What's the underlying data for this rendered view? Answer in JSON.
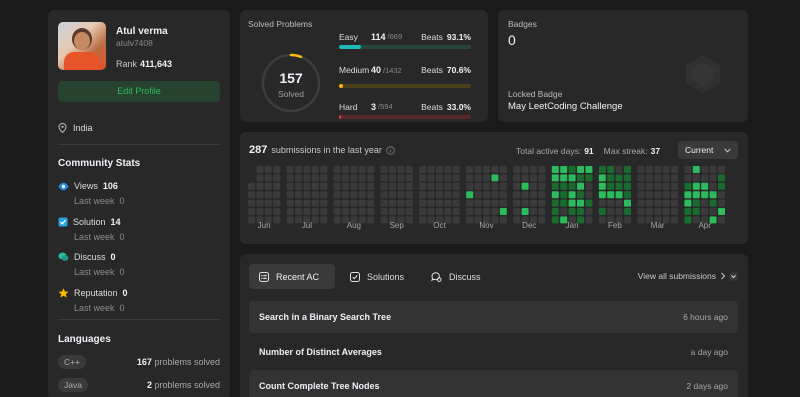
{
  "colors": {
    "easy": "#1cbaba",
    "medium": "#ffb700",
    "hard": "#f63737",
    "accent": "#2cbb5d",
    "card": "#282828",
    "bg": "#1a1a1a"
  },
  "profile": {
    "name": "Atul verma",
    "username": "atulv7408",
    "rank_label": "Rank",
    "rank_value": "411,643",
    "edit_button": "Edit Profile",
    "location": "India"
  },
  "community": {
    "title": "Community Stats",
    "items": [
      {
        "label": "Views",
        "value": "106",
        "sub": "Last week",
        "sub_value": "0",
        "icon": "eye-icon"
      },
      {
        "label": "Solution",
        "value": "14",
        "sub": "Last week",
        "sub_value": "0",
        "icon": "check-square-icon"
      },
      {
        "label": "Discuss",
        "value": "0",
        "sub": "Last week",
        "sub_value": "0",
        "icon": "chat-icon"
      },
      {
        "label": "Reputation",
        "value": "0",
        "sub": "Last week",
        "sub_value": "0",
        "icon": "star-icon"
      }
    ]
  },
  "languages": {
    "title": "Languages",
    "items": [
      {
        "name": "C++",
        "count": "167",
        "suffix": "problems solved"
      },
      {
        "name": "Java",
        "count": "2",
        "suffix": "problems solved"
      }
    ]
  },
  "solved": {
    "title": "Solved Problems",
    "total": "157",
    "total_label": "Solved",
    "rows": [
      {
        "label": "Easy",
        "solved": "114",
        "total": "/669",
        "beats_label": "Beats",
        "beats": "93.1%",
        "fraction": 0.17
      },
      {
        "label": "Medium",
        "solved": "40",
        "total": "/1432",
        "beats_label": "Beats",
        "beats": "70.6%",
        "fraction": 0.03
      },
      {
        "label": "Hard",
        "solved": "3",
        "total": "/594",
        "beats_label": "Beats",
        "beats": "33.0%",
        "fraction": 0.005
      }
    ]
  },
  "badges": {
    "title": "Badges",
    "count": "0",
    "locked_label": "Locked Badge",
    "locked_name": "May LeetCoding Challenge"
  },
  "submissions": {
    "count": "287",
    "label": "submissions in the last year",
    "active_label": "Total active days:",
    "active_value": "91",
    "streak_label": "Max streak:",
    "streak_value": "37",
    "dropdown": "Current",
    "months": [
      "Jun",
      "Jul",
      "Aug",
      "Sep",
      "Oct",
      "Nov",
      "Dec",
      "Jan",
      "Feb",
      "Mar",
      "Apr"
    ],
    "activity_levels": [
      [
        0,
        0,
        0,
        0,
        0,
        0,
        0,
        0,
        0,
        0,
        0,
        0,
        0,
        0,
        0,
        0,
        0,
        0,
        0,
        0,
        0,
        0,
        0,
        0,
        0,
        0,
        0,
        0,
        0,
        0,
        0,
        0,
        0,
        0,
        0,
        0,
        0,
        0,
        0,
        0,
        0,
        0,
        0,
        0,
        0,
        0,
        0,
        0,
        0,
        0,
        0,
        0,
        0,
        0,
        0,
        0,
        0,
        0,
        0,
        0,
        0,
        0,
        0,
        0,
        0,
        0,
        0,
        0,
        0,
        0,
        0,
        0,
        0,
        0,
        0,
        0,
        0,
        0,
        0,
        0,
        0,
        0,
        0,
        0,
        0,
        0,
        0,
        0,
        0,
        0,
        0,
        0,
        0,
        0,
        0,
        0,
        0,
        0,
        0,
        0,
        0,
        0,
        0,
        0,
        0,
        0,
        0,
        0,
        0,
        0,
        0,
        0,
        0,
        0,
        0,
        0,
        0,
        0,
        0,
        0,
        0,
        0,
        0,
        0,
        0,
        0,
        0,
        0,
        0,
        0,
        0,
        0,
        0,
        0,
        0,
        0,
        0,
        0,
        0,
        0,
        0,
        0,
        0,
        0,
        0,
        0,
        0,
        0,
        0,
        0,
        0,
        0,
        0,
        0,
        0,
        0,
        0,
        0,
        0,
        0,
        0,
        0,
        0,
        0,
        0,
        0,
        0,
        0,
        0,
        0,
        0,
        0,
        0,
        0,
        0,
        0,
        0,
        0,
        0,
        0,
        0,
        0,
        0,
        0,
        0,
        0,
        0,
        0,
        0,
        0,
        0,
        0,
        0,
        0,
        0,
        0,
        0,
        0,
        0,
        0,
        0,
        0,
        0,
        0,
        0,
        0,
        0,
        0,
        0,
        0,
        0,
        0,
        0,
        0,
        0,
        0,
        0,
        0,
        0,
        0,
        0,
        0,
        0,
        0,
        0,
        0,
        0,
        0,
        0,
        0,
        0,
        0,
        0,
        0,
        0,
        0,
        0,
        0,
        0,
        0,
        0,
        0,
        0,
        0,
        0,
        0,
        0,
        0,
        0,
        0,
        0,
        0,
        0,
        0,
        0,
        0,
        0,
        0,
        0,
        0,
        0,
        0,
        0,
        0,
        0,
        0,
        0,
        0,
        0,
        0,
        0,
        0,
        0,
        0,
        0,
        0,
        0,
        0,
        0,
        0,
        0,
        0,
        0,
        0,
        0,
        0,
        0,
        0,
        0,
        0,
        0,
        0,
        0,
        0,
        0,
        0,
        0,
        0,
        0,
        0,
        0,
        0,
        0,
        0,
        0,
        0,
        0,
        0,
        0,
        0,
        0,
        0,
        0,
        0,
        0,
        0,
        0,
        0,
        0,
        0,
        0,
        0,
        0,
        0,
        0,
        0,
        0,
        0,
        0,
        0,
        0,
        0,
        0,
        0,
        0,
        0,
        0,
        0,
        0,
        0,
        0,
        0,
        0,
        0,
        0,
        0,
        0,
        0,
        0,
        0,
        0,
        0,
        0,
        0,
        0,
        0,
        0,
        0,
        0,
        0,
        0,
        0,
        0,
        0,
        0,
        0,
        0,
        0,
        0,
        0,
        0,
        0,
        0,
        0,
        0,
        0,
        0,
        0,
        0,
        0,
        0,
        0,
        0,
        0,
        0,
        0,
        0,
        0,
        0,
        0,
        0,
        0,
        0,
        0,
        0
      ]
    ]
  },
  "tabs": {
    "items": [
      {
        "label": "Recent AC",
        "icon": "list-icon",
        "active": true
      },
      {
        "label": "Solutions",
        "icon": "check-square-icon",
        "active": false
      },
      {
        "label": "Discuss",
        "icon": "chat-icon",
        "active": false
      }
    ],
    "view_all": "View all submissions"
  },
  "recent": [
    {
      "title": "Search in a Binary Search Tree",
      "time": "6 hours ago"
    },
    {
      "title": "Number of Distinct Averages",
      "time": "a day ago"
    },
    {
      "title": "Count Complete Tree Nodes",
      "time": "2 days ago"
    }
  ]
}
